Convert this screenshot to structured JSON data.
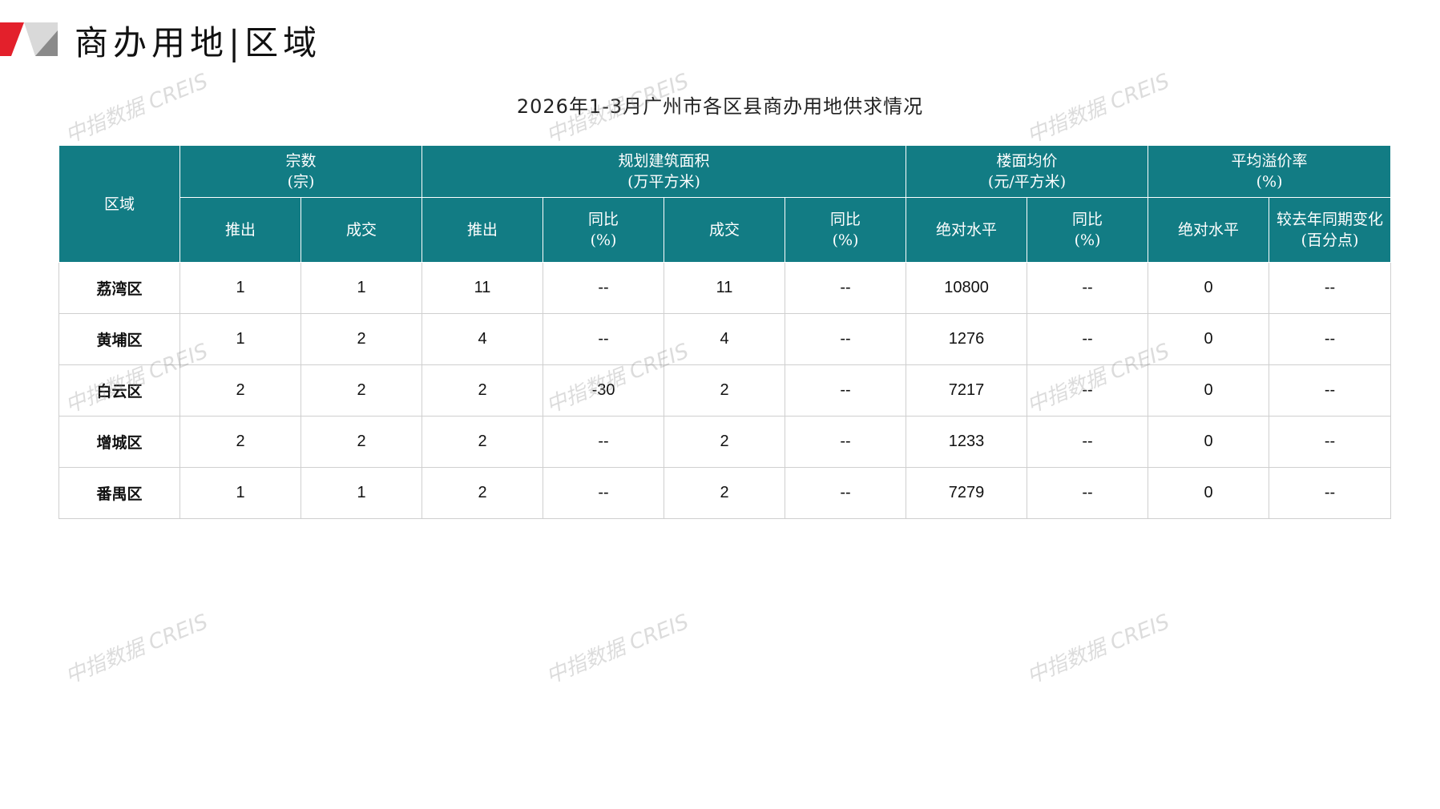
{
  "page": {
    "title": "商办用地|区域",
    "table_title": "2026年1-3月广州市各区县商办用地供求情况"
  },
  "colors": {
    "header_bg": "#127c84",
    "logo_red": "#e3202b",
    "logo_gray": "#8a8a8a"
  },
  "watermark_text": "中指数据 CREIS",
  "table": {
    "headers": {
      "region": "区域",
      "groups": {
        "count": "宗数\n(宗)",
        "area": "规划建筑面积\n(万平方米)",
        "price": "楼面均价\n(元/平方米)",
        "premium": "平均溢价率\n(%)"
      },
      "sub": {
        "count_launch": "推出",
        "count_deal": "成交",
        "area_launch": "推出",
        "area_launch_yoy": "同比\n(%)",
        "area_deal": "成交",
        "area_deal_yoy": "同比\n(%)",
        "price_abs": "绝对水平",
        "price_yoy": "同比\n(%)",
        "premium_abs": "绝对水平",
        "premium_change": "较去年同期变化\n(百分点)"
      }
    },
    "rows": [
      {
        "region": "荔湾区",
        "count_launch": "1",
        "count_deal": "1",
        "area_launch": "11",
        "area_launch_yoy": "--",
        "area_deal": "11",
        "area_deal_yoy": "--",
        "price_abs": "10800",
        "price_yoy": "--",
        "premium_abs": "0",
        "premium_change": "--"
      },
      {
        "region": "黄埔区",
        "count_launch": "1",
        "count_deal": "2",
        "area_launch": "4",
        "area_launch_yoy": "--",
        "area_deal": "4",
        "area_deal_yoy": "--",
        "price_abs": "1276",
        "price_yoy": "--",
        "premium_abs": "0",
        "premium_change": "--"
      },
      {
        "region": "白云区",
        "count_launch": "2",
        "count_deal": "2",
        "area_launch": "2",
        "area_launch_yoy": "-30",
        "area_deal": "2",
        "area_deal_yoy": "--",
        "price_abs": "7217",
        "price_yoy": "--",
        "premium_abs": "0",
        "premium_change": "--"
      },
      {
        "region": "增城区",
        "count_launch": "2",
        "count_deal": "2",
        "area_launch": "2",
        "area_launch_yoy": "--",
        "area_deal": "2",
        "area_deal_yoy": "--",
        "price_abs": "1233",
        "price_yoy": "--",
        "premium_abs": "0",
        "premium_change": "--"
      },
      {
        "region": "番禺区",
        "count_launch": "1",
        "count_deal": "1",
        "area_launch": "2",
        "area_launch_yoy": "--",
        "area_deal": "2",
        "area_deal_yoy": "--",
        "price_abs": "7279",
        "price_yoy": "--",
        "premium_abs": "0",
        "premium_change": "--"
      }
    ]
  }
}
